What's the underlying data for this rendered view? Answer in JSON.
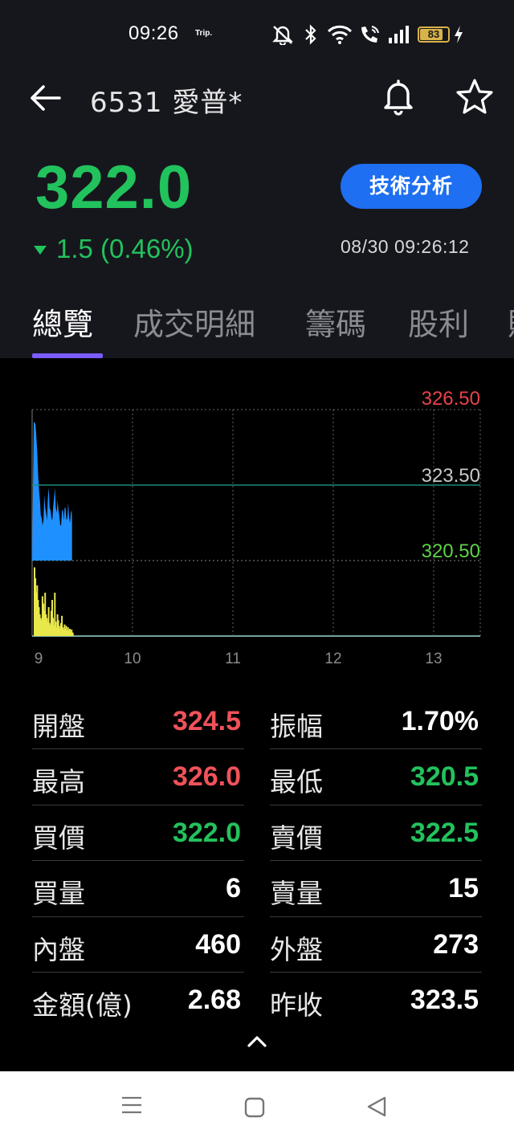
{
  "status_bar": {
    "time": "09:26",
    "trip_label": "Trip.",
    "battery_level": "83",
    "icons": [
      "mute-icon",
      "bluetooth-icon",
      "wifi-icon",
      "wifi-calling-icon",
      "signal-icon",
      "battery-icon",
      "charging-icon"
    ]
  },
  "header": {
    "title": "6531 愛普*",
    "icons": [
      "back-arrow-icon",
      "bell-icon",
      "star-icon"
    ]
  },
  "quote": {
    "price": "322.0",
    "change": "1.5 (0.46%)",
    "direction": "down",
    "timestamp": "08/30 09:26:12",
    "tech_button_label": "技術分析"
  },
  "tabs": [
    {
      "label": "總覽",
      "active": true
    },
    {
      "label": "成交明細",
      "active": false
    },
    {
      "label": "籌碼",
      "active": false
    },
    {
      "label": "股利",
      "active": false
    },
    {
      "label": "財",
      "active": false
    }
  ],
  "chart_data": {
    "type": "line",
    "x_tick_labels": [
      "9",
      "10",
      "11",
      "12",
      "13"
    ],
    "y_labels": {
      "high": "326.50",
      "ref": "323.50",
      "low": "320.50"
    },
    "ylim": [
      320.5,
      326.5
    ],
    "reference": 323.5,
    "price_series": {
      "x_minutes": [
        0,
        0.6,
        1.2,
        1.8,
        2.4,
        3,
        3.6,
        4.2,
        4.8,
        5.4,
        6,
        6.6,
        7.2,
        7.8,
        8.4,
        9,
        9.6,
        10.2,
        10.8,
        11.4,
        12,
        12.6,
        13.2,
        13.8,
        14.4,
        15,
        15.6,
        16.2,
        16.8,
        17.4,
        18,
        18.6,
        19.2,
        19.8,
        20.4,
        21,
        21.6,
        22.2,
        22.8,
        23.4,
        24,
        24.6,
        25.2,
        25.8,
        26
      ],
      "y": [
        326.0,
        326.0,
        325.9,
        325.4,
        324.8,
        323.9,
        323.3,
        322.9,
        322.3,
        322.2,
        321.9,
        322.1,
        323.1,
        322.6,
        322.4,
        322.1,
        323.0,
        323.4,
        322.6,
        322.5,
        322.2,
        322.1,
        322.6,
        323.0,
        323.4,
        322.6,
        322.4,
        322.9,
        322.5,
        322.3,
        321.9,
        321.9,
        322.5,
        322.5,
        322.1,
        322.6,
        322.6,
        322.1,
        322.2,
        322.8,
        322.2,
        322.0,
        322.4,
        322.5,
        322.0
      ]
    },
    "volume_series": {
      "x_minutes": [
        0,
        0.6,
        1.2,
        1.8,
        2.4,
        3,
        3.6,
        4.2,
        4.8,
        5.4,
        6,
        6.6,
        7.2,
        7.8,
        8.4,
        9,
        9.6,
        10.2,
        10.8,
        11.4,
        12,
        12.6,
        13.2,
        13.8,
        14.4,
        15,
        15.6,
        16.2,
        16.8,
        17.4,
        18,
        18.6,
        19.2,
        19.8,
        20.4,
        21,
        21.6,
        22.2,
        22.8,
        23.4,
        24,
        24.6,
        25.2,
        25.8,
        26
      ],
      "values": [
        95,
        80,
        60,
        70,
        50,
        40,
        30,
        25,
        22,
        55,
        45,
        35,
        60,
        30,
        25,
        20,
        40,
        18,
        15,
        35,
        50,
        25,
        15,
        60,
        20,
        12,
        30,
        22,
        14,
        10,
        18,
        28,
        12,
        9,
        16,
        10,
        14,
        8,
        12,
        7,
        10,
        6,
        9,
        5,
        4
      ]
    },
    "colors": {
      "price_fill": "#1e90ff",
      "volume": "#e8e84a",
      "ref_line": "#1a8a7a",
      "high_label": "#e8434c",
      "ref_label": "#c8c8c8",
      "low_label": "#5fd14a"
    }
  },
  "stats": {
    "left": [
      {
        "label": "開盤",
        "value": "324.5",
        "color": "red"
      },
      {
        "label": "最高",
        "value": "326.0",
        "color": "red"
      },
      {
        "label": "買價",
        "value": "322.0",
        "color": "green"
      },
      {
        "label": "買量",
        "value": "6",
        "color": "white"
      },
      {
        "label": "內盤",
        "value": "460",
        "color": "white"
      },
      {
        "label": "金額(億)",
        "value": "2.68",
        "color": "white"
      }
    ],
    "right": [
      {
        "label": "振幅",
        "value": "1.70%",
        "color": "white"
      },
      {
        "label": "最低",
        "value": "320.5",
        "color": "green"
      },
      {
        "label": "賣價",
        "value": "322.5",
        "color": "green"
      },
      {
        "label": "賣量",
        "value": "15",
        "color": "white"
      },
      {
        "label": "外盤",
        "value": "273",
        "color": "white"
      },
      {
        "label": "昨收",
        "value": "323.5",
        "color": "white"
      }
    ]
  },
  "nav_bar": {
    "icons": [
      "menu-icon",
      "home-icon",
      "back-triangle-icon"
    ]
  }
}
